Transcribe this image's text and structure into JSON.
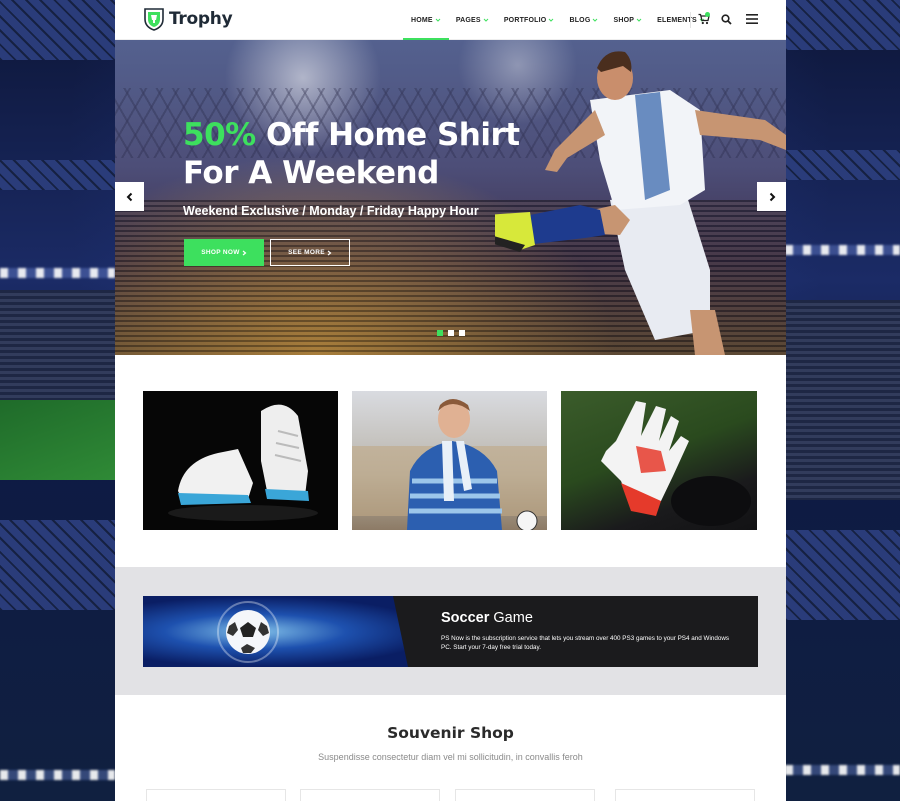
{
  "brand": {
    "name": "Trophy",
    "accent": "#3de05e"
  },
  "nav": {
    "items": [
      {
        "label": "HOME",
        "active": true
      },
      {
        "label": "PAGES"
      },
      {
        "label": "PORTFOLIO"
      },
      {
        "label": "BLOG"
      },
      {
        "label": "SHOP"
      },
      {
        "label": "ELEMENTS"
      }
    ],
    "icons": [
      "cart-icon",
      "search-icon",
      "menu-icon"
    ]
  },
  "hero": {
    "title_highlight": "50%",
    "title_line1_rest": " Off Home Shirt",
    "title_line2": "For A Weekend",
    "subtitle": "Weekend Exclusive / Monday / Friday Happy Hour",
    "shop_button": "SHOP NOW",
    "more_button": "SEE MORE",
    "slides": 3,
    "active_slide": 1
  },
  "tiles": [
    "football-boots",
    "football-fan",
    "goalkeeper-gloves"
  ],
  "promo": {
    "title_bold": "Soccer",
    "title_rest": " Game",
    "text": "PS Now is the subscription service that lets you stream over 400 PS3 games to your PS4 and Windows PC. Start your 7-day free trial today."
  },
  "souvenir": {
    "title": "Souvenir Shop",
    "subtitle": "Suspendisse consectetur diam vel mi sollicitudin, in convallis feroh"
  }
}
